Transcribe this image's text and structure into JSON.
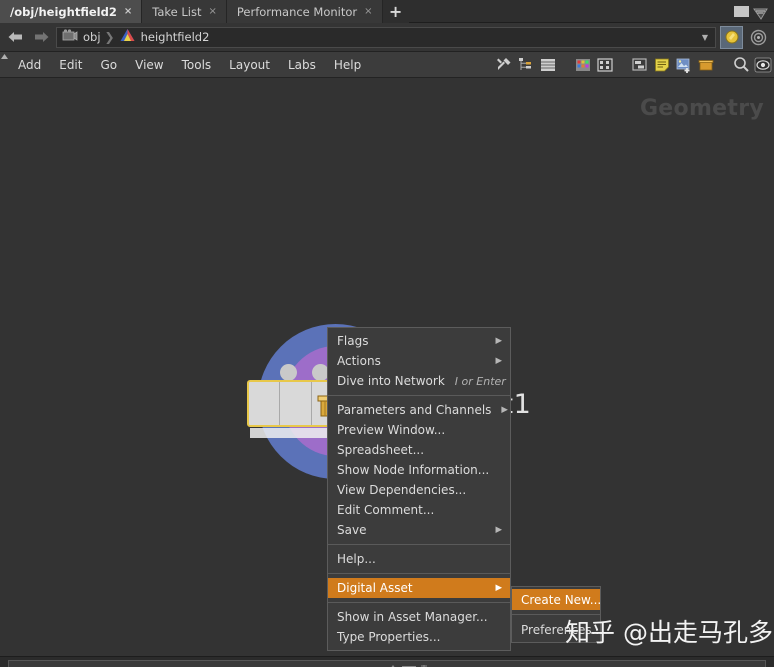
{
  "window": {
    "tabs": [
      {
        "label": "/obj/heightfield2",
        "close": "×",
        "active": true
      },
      {
        "label": "Take List",
        "close": "×",
        "active": false
      },
      {
        "label": "Performance Monitor",
        "close": "×",
        "active": false
      }
    ],
    "new_tab": "+",
    "controls": {
      "restore_icon": "restore-icon",
      "close_icon": "close-icon"
    }
  },
  "pathbar": {
    "back_icon": "back-arrow-icon",
    "forward_icon": "forward-arrow-icon",
    "crumbs": [
      {
        "icon": "obj-network-icon",
        "label": "obj"
      },
      {
        "icon": "geometry-node-icon",
        "label": "heightfield2"
      }
    ],
    "separator": "❯",
    "dropdown_icon": "chevron-down-icon",
    "buttons": [
      {
        "icon": "pin-icon",
        "selected": true
      },
      {
        "icon": "target-icon",
        "selected": false
      }
    ]
  },
  "menubar": {
    "items": [
      "Add",
      "Edit",
      "Go",
      "View",
      "Tools",
      "Layout",
      "Labs",
      "Help"
    ],
    "tools": [
      "tools-wrench-icon",
      "hierarchy-icon",
      "list-icon",
      "color-palette-icon",
      "grid-icon",
      "network-box-icon",
      "sticky-note-icon",
      "add-image-icon",
      "subnet-box-icon",
      "search-icon",
      "eye-icon"
    ]
  },
  "network": {
    "watermark": "Geometry",
    "node": {
      "label": "subnet1",
      "type_icon": "subnet-box-icon",
      "selected": true,
      "selection_color": "#e8c84a",
      "flag_color": "#23a9e8",
      "circle_outer_color": "#5b72b8",
      "circle_inner_color": "#9d6dc9"
    }
  },
  "context_menu": {
    "items": [
      {
        "label": "Flags",
        "arrow": "▶",
        "accel": "",
        "highlight": false,
        "sep_after": false
      },
      {
        "label": "Actions",
        "arrow": "▶",
        "accel": "",
        "highlight": false,
        "sep_after": false
      },
      {
        "label": "Dive into Network",
        "arrow": "",
        "accel": "I or Enter",
        "highlight": false,
        "sep_after": true
      },
      {
        "label": "Parameters and Channels",
        "arrow": "▶",
        "accel": "",
        "highlight": false,
        "sep_after": false
      },
      {
        "label": "Preview Window...",
        "arrow": "",
        "accel": "",
        "highlight": false,
        "sep_after": false
      },
      {
        "label": "Spreadsheet...",
        "arrow": "",
        "accel": "",
        "highlight": false,
        "sep_after": false
      },
      {
        "label": "Show Node Information...",
        "arrow": "",
        "accel": "",
        "highlight": false,
        "sep_after": false
      },
      {
        "label": "View Dependencies...",
        "arrow": "",
        "accel": "",
        "highlight": false,
        "sep_after": false
      },
      {
        "label": "Edit Comment...",
        "arrow": "",
        "accel": "",
        "highlight": false,
        "sep_after": false
      },
      {
        "label": "Save",
        "arrow": "▶",
        "accel": "",
        "highlight": false,
        "sep_after": true
      },
      {
        "label": "Help...",
        "arrow": "",
        "accel": "",
        "highlight": false,
        "sep_after": true
      },
      {
        "label": "Digital Asset",
        "arrow": "▶",
        "accel": "",
        "highlight": true,
        "sep_after": true
      },
      {
        "label": "Show in Asset Manager...",
        "arrow": "",
        "accel": "",
        "highlight": false,
        "sep_after": false
      },
      {
        "label": "Type Properties...",
        "arrow": "",
        "accel": "",
        "highlight": false,
        "sep_after": false
      }
    ],
    "highlight_color": "#d07b1c"
  },
  "submenu": {
    "items": [
      {
        "label": "Create New...",
        "highlight": true,
        "sep_after": true
      },
      {
        "label": "Preferences...",
        "highlight": false,
        "sep_after": false
      }
    ]
  },
  "watermark": {
    "text": "知乎 @出走马孔多"
  }
}
